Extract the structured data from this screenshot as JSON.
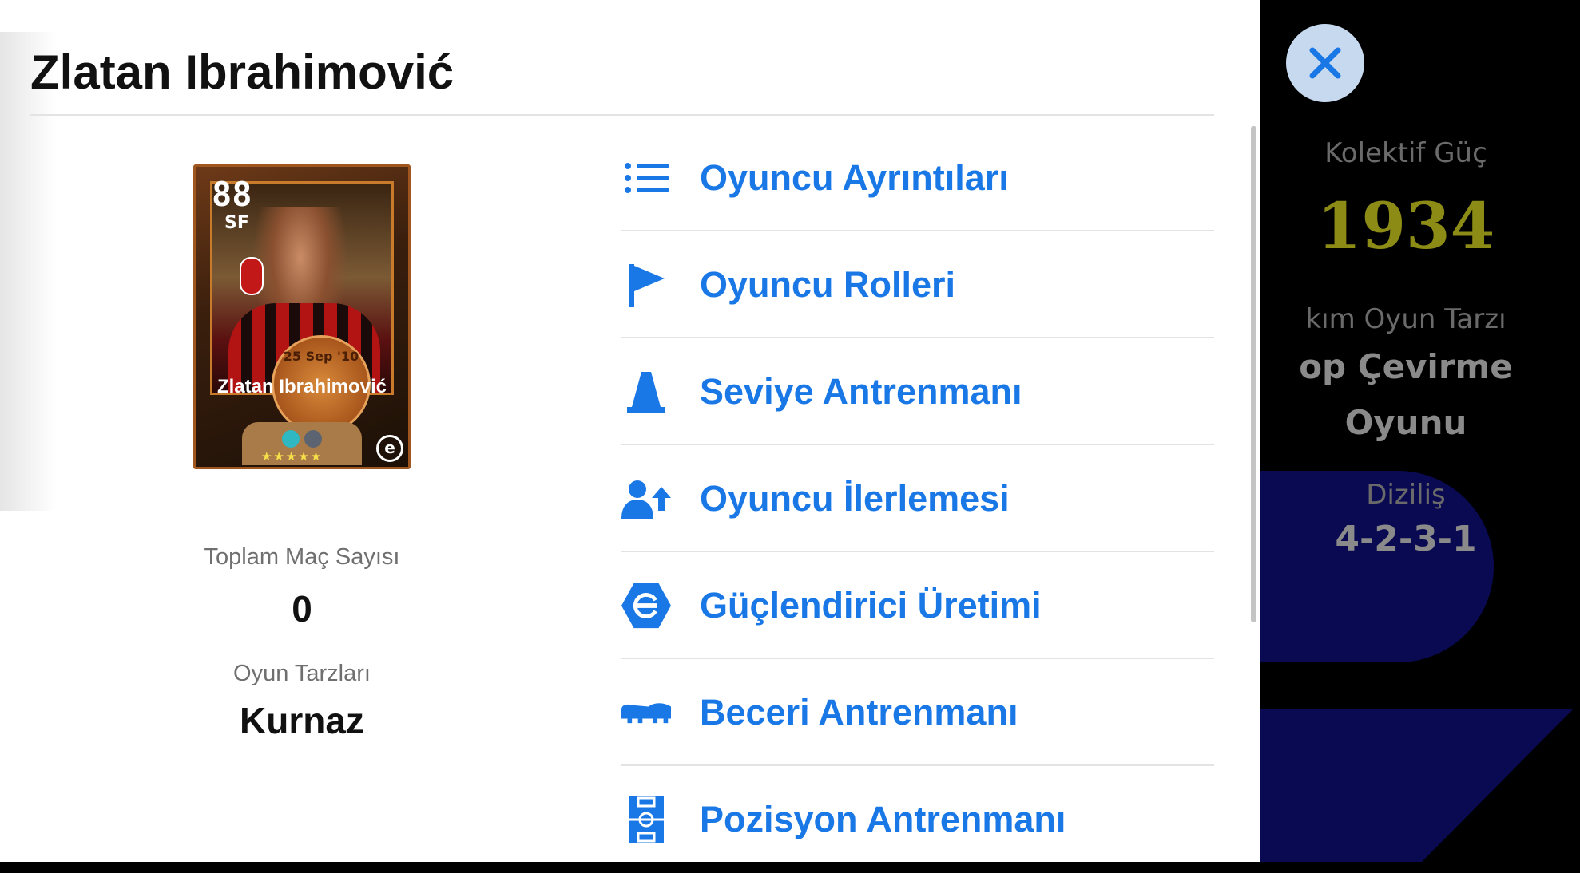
{
  "player": {
    "name": "Zlatan Ibrahimović",
    "card": {
      "rating": "88",
      "position": "SF",
      "name": "Zlatan Ibrahimović",
      "date_day": "25",
      "date_month": "Sep",
      "date_year": "'10",
      "stars": "★★★★★",
      "chip_colors": [
        "#2fb7c2",
        "#5b6470"
      ]
    }
  },
  "stats": {
    "matches_label": "Toplam Maç Sayısı",
    "matches_value": "0",
    "playstyle_label": "Oyun Tarzları",
    "playstyle_value": "Kurnaz"
  },
  "menu": {
    "items": [
      {
        "label": "Oyuncu Ayrıntıları",
        "icon": "list-icon"
      },
      {
        "label": "Oyuncu Rolleri",
        "icon": "flag-icon"
      },
      {
        "label": "Seviye Antrenmanı",
        "icon": "training-cone-icon"
      },
      {
        "label": "Oyuncu İlerlemesi",
        "icon": "player-progress-icon"
      },
      {
        "label": "Güçlendirici Üretimi",
        "icon": "efootball-logo-icon"
      },
      {
        "label": "Beceri Antrenmanı",
        "icon": "football-boot-icon"
      },
      {
        "label": "Pozisyon Antrenmanı",
        "icon": "pitch-icon"
      }
    ],
    "accent_color": "#1a78e6"
  },
  "team": {
    "power_label": "Kolektif Güç",
    "power_value": "1934",
    "style_label": "kım Oyun Tarzı",
    "style_value_line1": "op Çevirme",
    "style_value_line2": "Oyunu",
    "formation_label": "Diziliş",
    "formation_value": "4-2-3-1"
  },
  "close_icon": "close-icon"
}
